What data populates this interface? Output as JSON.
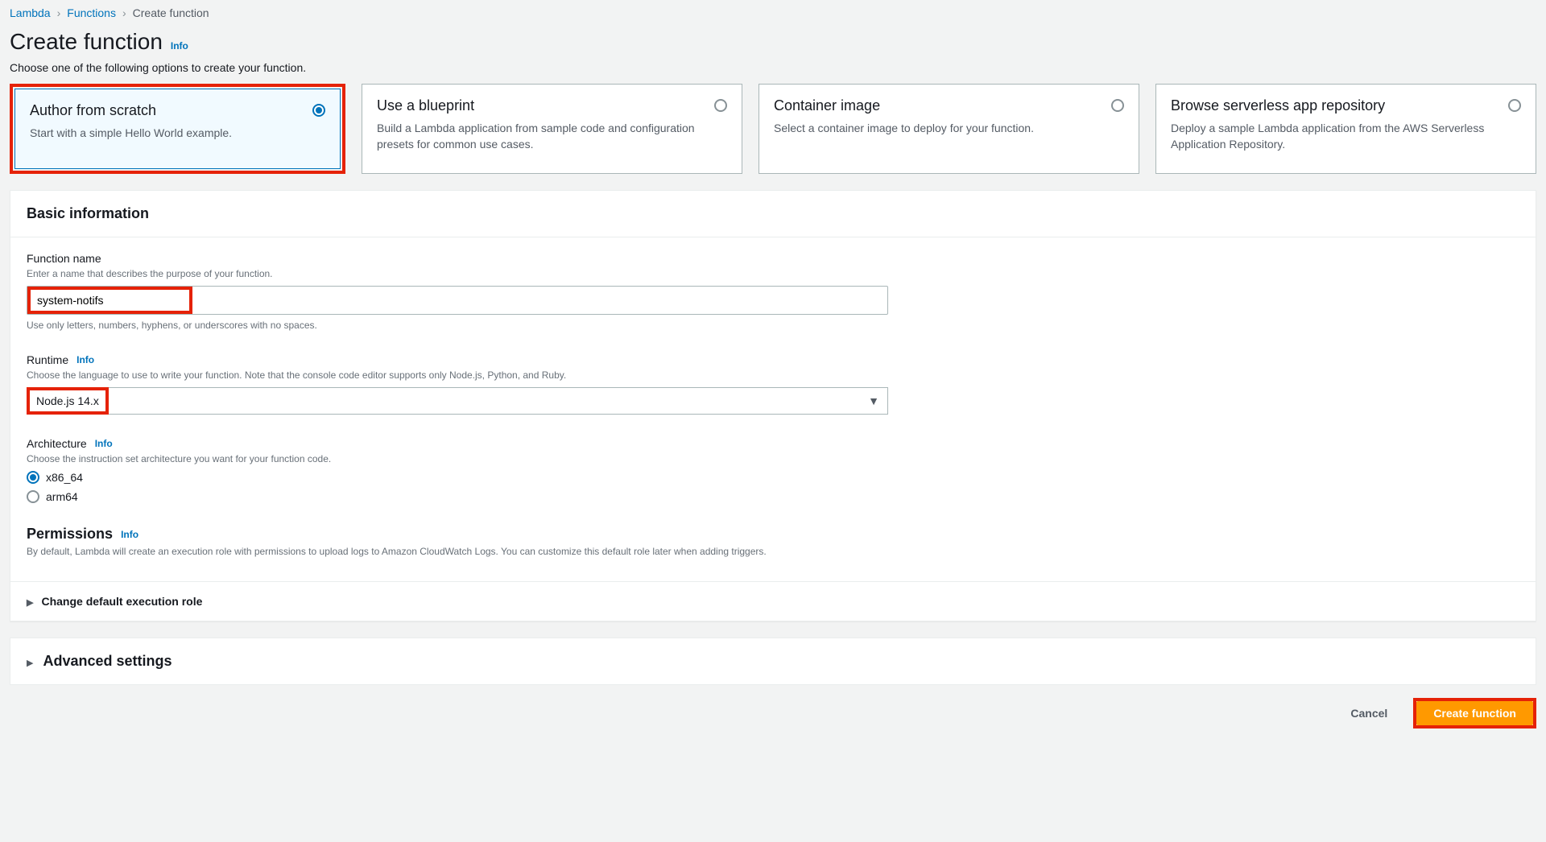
{
  "breadcrumb": {
    "items": [
      "Lambda",
      "Functions"
    ],
    "current": "Create function"
  },
  "header": {
    "title": "Create function",
    "info": "Info",
    "subtitle": "Choose one of the following options to create your function."
  },
  "options": [
    {
      "title": "Author from scratch",
      "desc": "Start with a simple Hello World example.",
      "selected": true
    },
    {
      "title": "Use a blueprint",
      "desc": "Build a Lambda application from sample code and configuration presets for common use cases.",
      "selected": false
    },
    {
      "title": "Container image",
      "desc": "Select a container image to deploy for your function.",
      "selected": false
    },
    {
      "title": "Browse serverless app repository",
      "desc": "Deploy a sample Lambda application from the AWS Serverless Application Repository.",
      "selected": false
    }
  ],
  "basic": {
    "title": "Basic information",
    "functionName": {
      "label": "Function name",
      "desc": "Enter a name that describes the purpose of your function.",
      "value": "system-notifs",
      "hint": "Use only letters, numbers, hyphens, or underscores with no spaces."
    },
    "runtime": {
      "label": "Runtime",
      "info": "Info",
      "desc": "Choose the language to use to write your function. Note that the console code editor supports only Node.js, Python, and Ruby.",
      "value": "Node.js 14.x"
    },
    "architecture": {
      "label": "Architecture",
      "info": "Info",
      "desc": "Choose the instruction set architecture you want for your function code.",
      "options": [
        {
          "label": "x86_64",
          "checked": true
        },
        {
          "label": "arm64",
          "checked": false
        }
      ]
    },
    "permissions": {
      "label": "Permissions",
      "info": "Info",
      "desc": "By default, Lambda will create an execution role with permissions to upload logs to Amazon CloudWatch Logs. You can customize this default role later when adding triggers."
    },
    "expandRole": "Change default execution role"
  },
  "advanced": {
    "title": "Advanced settings"
  },
  "footer": {
    "cancel": "Cancel",
    "create": "Create function"
  }
}
